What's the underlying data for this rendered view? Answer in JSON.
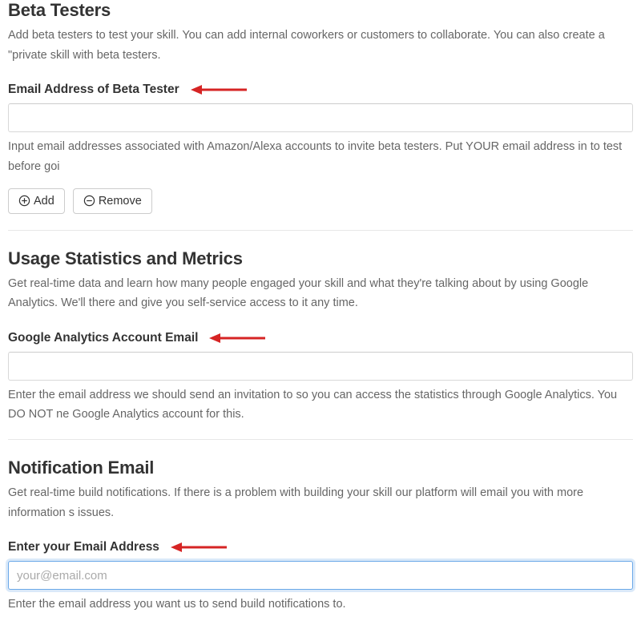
{
  "sections": {
    "beta": {
      "title": "Beta Testers",
      "description": "Add beta testers to test your skill. You can add internal coworkers or customers to collaborate. You can also create a \"private skill with beta testers.",
      "field_label": "Email Address of Beta Tester",
      "input_value": "",
      "help": "Input email addresses associated with Amazon/Alexa accounts to invite beta testers. Put YOUR email address in to test before goi",
      "add_label": "Add",
      "remove_label": "Remove"
    },
    "usage": {
      "title": "Usage Statistics and Metrics",
      "description": "Get real-time data and learn how many people engaged your skill and what they're talking about by using Google Analytics. We'll there and give you self-service access to it any time.",
      "field_label": "Google Analytics Account Email",
      "input_value": "",
      "help": "Enter the email address we should send an invitation to so you can access the statistics through Google Analytics. You DO NOT ne Google Analytics account for this."
    },
    "notification": {
      "title": "Notification Email",
      "description": "Get real-time build notifications. If there is a problem with building your skill our platform will email you with more information s issues.",
      "field_label": "Enter your Email Address",
      "input_placeholder": "your@email.com",
      "input_value": "",
      "help": "Enter the email address you want us to send build notifications to."
    }
  },
  "colors": {
    "arrow": "#d62424"
  }
}
